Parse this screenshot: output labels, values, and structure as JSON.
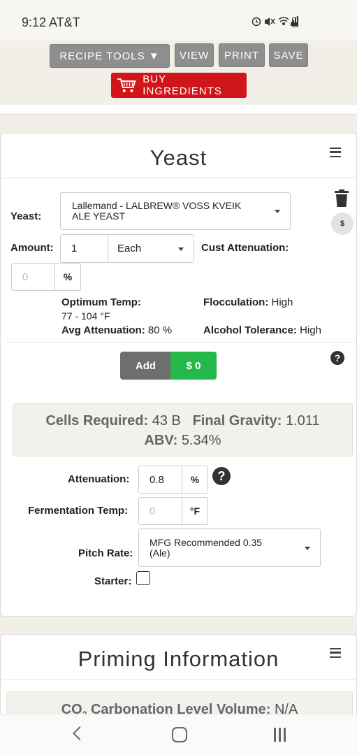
{
  "status_bar": {
    "time": "9:12 AT&T",
    "icons": [
      "alarm-icon",
      "mute-icon",
      "wifi-icon",
      "signal-icon",
      "battery-icon"
    ]
  },
  "toolbar": {
    "recipe_tools": "RECIPE TOOLS ▼",
    "view": "VIEW",
    "print": "PRINT",
    "save": "SAVE",
    "buy_ingredients": "BUY INGREDIENTS"
  },
  "yeast": {
    "title": "Yeast",
    "yeast_label": "Yeast:",
    "yeast_line1": "Lallemand - LALBREW® VOSS KVEIK",
    "yeast_line2": "ALE YEAST",
    "amount_label": "Amount:",
    "amount_value": "1",
    "amount_unit": "Each",
    "cust_atten_label": "Cust Attenuation:",
    "cust_atten_placeholder": "0",
    "percent": "%",
    "dollar": "$",
    "optimum_temp_label": "Optimum Temp:",
    "optimum_temp_value": "77 - 104 °F",
    "flocculation_label": "Flocculation:",
    "flocculation_value": "High",
    "avg_atten_label": "Avg Attenuation:",
    "avg_atten_value": "80 %",
    "alcohol_tol_label": "Alcohol Tolerance:",
    "alcohol_tol_value": "High",
    "add_button": "Add",
    "cost_button": "$ 0",
    "help": "?",
    "cells_label": "Cells Required:",
    "cells_value": "43 B",
    "fg_label": "Final Gravity:",
    "fg_value": "1.011",
    "abv_label": "ABV:",
    "abv_value": "5.34%",
    "attenuation_label": "Attenuation:",
    "attenuation_value": "0.8",
    "ferm_temp_label": "Fermentation Temp:",
    "ferm_temp_placeholder": "0",
    "ferm_temp_unit": "°F",
    "pitch_label": "Pitch Rate:",
    "pitch_line1": "MFG Recommended 0.35",
    "pitch_line2": "(Ale)",
    "starter_label": "Starter:",
    "starter_checked": false
  },
  "priming": {
    "title": "Priming Information",
    "co2_label_prefix": "CO",
    "co2_subscript": "2",
    "co2_label_suffix": " Carbonation Level Volume:",
    "co2_value": "N/A"
  },
  "colors": {
    "buy_red": "#d0161b",
    "cost_green": "#24b84b",
    "tool_gray": "#8e8e8e"
  }
}
